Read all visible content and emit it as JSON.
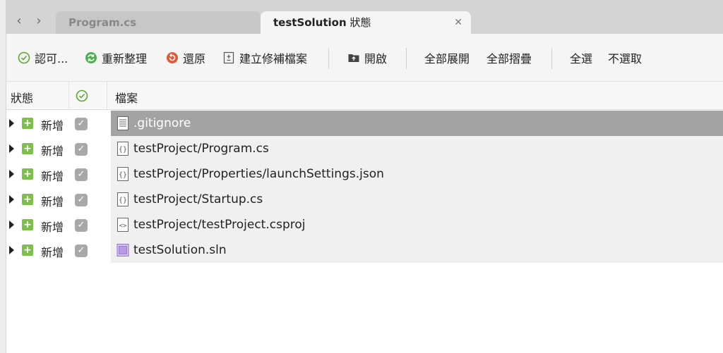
{
  "tabs": {
    "inactive_label": "Program.cs",
    "active_label": "testSolution",
    "active_suffix": "狀態"
  },
  "toolbar": {
    "approve_label": "認可...",
    "refresh_label": "重新整理",
    "revert_label": "還原",
    "patch_label": "建立修補檔案",
    "open_label": "開啟",
    "expand_all_label": "全部展開",
    "collapse_all_label": "全部摺疊",
    "select_all_label": "全選",
    "deselect_label": "不選取"
  },
  "header": {
    "status_label": "狀態",
    "file_label": "檔案"
  },
  "rows": [
    {
      "status": "新增",
      "file": ".gitignore",
      "icon": "text-file-icon",
      "selected": true
    },
    {
      "status": "新增",
      "file": "testProject/Program.cs",
      "icon": "code-file-icon",
      "selected": false
    },
    {
      "status": "新增",
      "file": "testProject/Properties/launchSettings.json",
      "icon": "code-file-icon",
      "selected": false
    },
    {
      "status": "新增",
      "file": "testProject/Startup.cs",
      "icon": "code-file-icon",
      "selected": false
    },
    {
      "status": "新增",
      "file": "testProject/testProject.csproj",
      "icon": "xml-file-icon",
      "selected": false
    },
    {
      "status": "新增",
      "file": "testSolution.sln",
      "icon": "solution-file-icon",
      "selected": false
    }
  ],
  "colors": {
    "accent_green": "#7cc04b",
    "refresh_green": "#4caf50",
    "revert_red": "#e05a3a",
    "selected_row": "#a3a3a3"
  }
}
